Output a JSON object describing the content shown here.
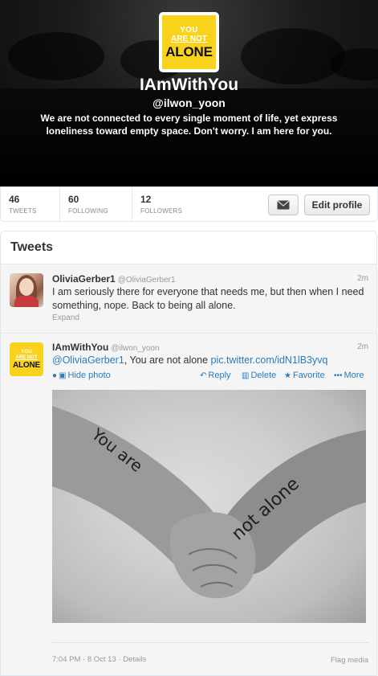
{
  "profile": {
    "logo_line1": "YOU",
    "logo_line2": "ARE NOT",
    "logo_line3": "ALONE",
    "name": "IAmWithYou",
    "handle": "@ilwon_yoon",
    "bio": "We are not connected to every single moment of life, yet express loneliness toward empty space. Don't worry. I am here for you."
  },
  "stats": [
    {
      "count": "46",
      "label": "TWEETS"
    },
    {
      "count": "60",
      "label": "FOLLOWING"
    },
    {
      "count": "12",
      "label": "FOLLOWERS"
    }
  ],
  "buttons": {
    "edit_profile": "Edit profile",
    "message_icon": "envelope-icon"
  },
  "tweets_header": "Tweets",
  "tweets": [
    {
      "name": "OliviaGerber1",
      "handle": "@OliviaGerber1",
      "time": "2m",
      "text": "I am seriously there for everyone that needs me, but then when I need something, nope. Back to being all alone.",
      "expand": "Expand"
    },
    {
      "name": "IAmWithYou",
      "handle": "@ilwon_yoon",
      "time": "2m",
      "mention": "@OliviaGerber1",
      "text": ", You are not alone ",
      "link": "pic.twitter.com/idN1lB3yvq",
      "actions": {
        "hide_photo": "Hide photo",
        "reply": "Reply",
        "delete": "Delete",
        "favorite": "Favorite",
        "more": "More"
      },
      "photo_text_1": "You are",
      "photo_text_2": "not alone",
      "footer_time": "7:04 PM - 8 Oct 13",
      "footer_details": "Details",
      "flag": "Flag media"
    }
  ],
  "colors": {
    "link": "#2b7bb9",
    "logo_yellow": "#f8d21b"
  }
}
